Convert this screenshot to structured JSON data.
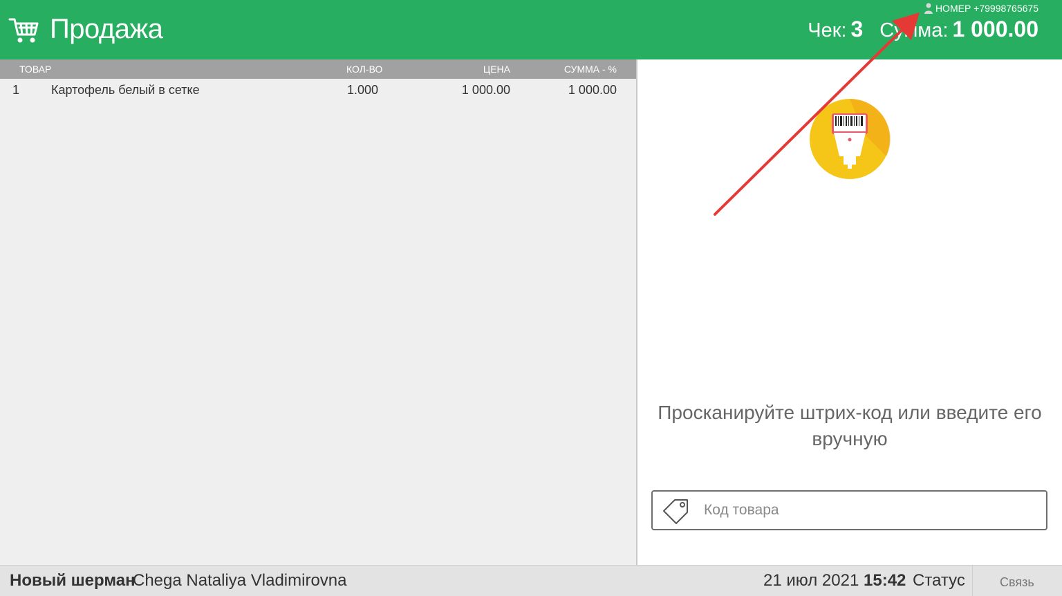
{
  "header": {
    "title": "Продажа",
    "customer_label": "НОМЕР +79998765675",
    "receipt_label": "Чек:",
    "receipt_number": "3",
    "sum_label": "Сумма:",
    "sum_value": "1 000.00",
    "background_color": "#27ae60"
  },
  "table": {
    "columns": [
      "ТОВАР",
      "КОЛ-ВО",
      "ЦЕНА",
      "СУММА - %"
    ],
    "rows": [
      {
        "index": "1",
        "name": "Картофель белый в сетке",
        "qty": "1.000",
        "price": "1 000.00",
        "sum": "1 000.00"
      }
    ]
  },
  "scan_panel": {
    "hint": "Просканируйте штрих-код или введите его вручную",
    "code_placeholder": "Код товара",
    "code_value": ""
  },
  "status_bar": {
    "shop_name": "Новый шерман",
    "cashier": "Chega Nataliya Vladimirovna",
    "date": "21 июл 2021",
    "time": "15:42",
    "status": "Статус",
    "connection": "Связь"
  },
  "icons": {
    "cart": "shopping-cart-icon",
    "person": "person-icon",
    "scanner": "barcode-scanner-icon",
    "tag": "price-tag-icon",
    "annotation": "red-arrow-annotation"
  },
  "colors": {
    "accent": "#27ae60",
    "scanner_circle": "#f5c518",
    "annotation_arrow": "#e53935"
  }
}
